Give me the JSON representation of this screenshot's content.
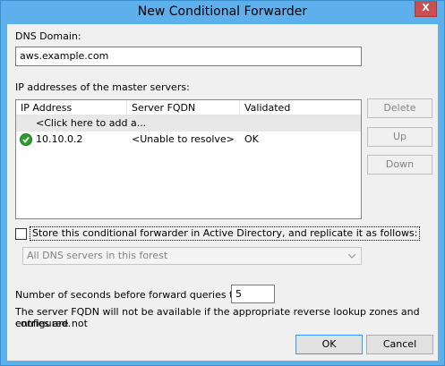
{
  "window": {
    "title": "New Conditional Forwarder",
    "close_glyph": "X"
  },
  "dns_domain": {
    "label": "DNS Domain:",
    "value": "aws.example.com"
  },
  "master_servers": {
    "label": "IP addresses of the master servers:",
    "columns": [
      "IP Address",
      "Server FQDN",
      "Validated"
    ],
    "add_placeholder": "<Click here to add a...",
    "rows": [
      {
        "ip": "10.10.0.2",
        "fqdn": "<Unable to resolve>",
        "validated": "OK",
        "icon": "green-check-icon"
      }
    ]
  },
  "side_buttons": {
    "delete": "Delete",
    "up": "Up",
    "down": "Down"
  },
  "replication": {
    "checkbox_label": "Store this conditional forwarder in Active Directory, and replicate it as follows:",
    "checked": false,
    "scope_value": "All DNS servers in this forest"
  },
  "timeout": {
    "label": "Number of seconds before forward queries time out:",
    "value": "5"
  },
  "note": {
    "line1": "The server FQDN will not be available if the appropriate reverse lookup zones and entries are not",
    "line2": "configured."
  },
  "footer": {
    "ok": "OK",
    "cancel": "Cancel"
  },
  "colors": {
    "titlebar": "#5db0ec",
    "close": "#c75050",
    "check": "#2e9c2e"
  }
}
